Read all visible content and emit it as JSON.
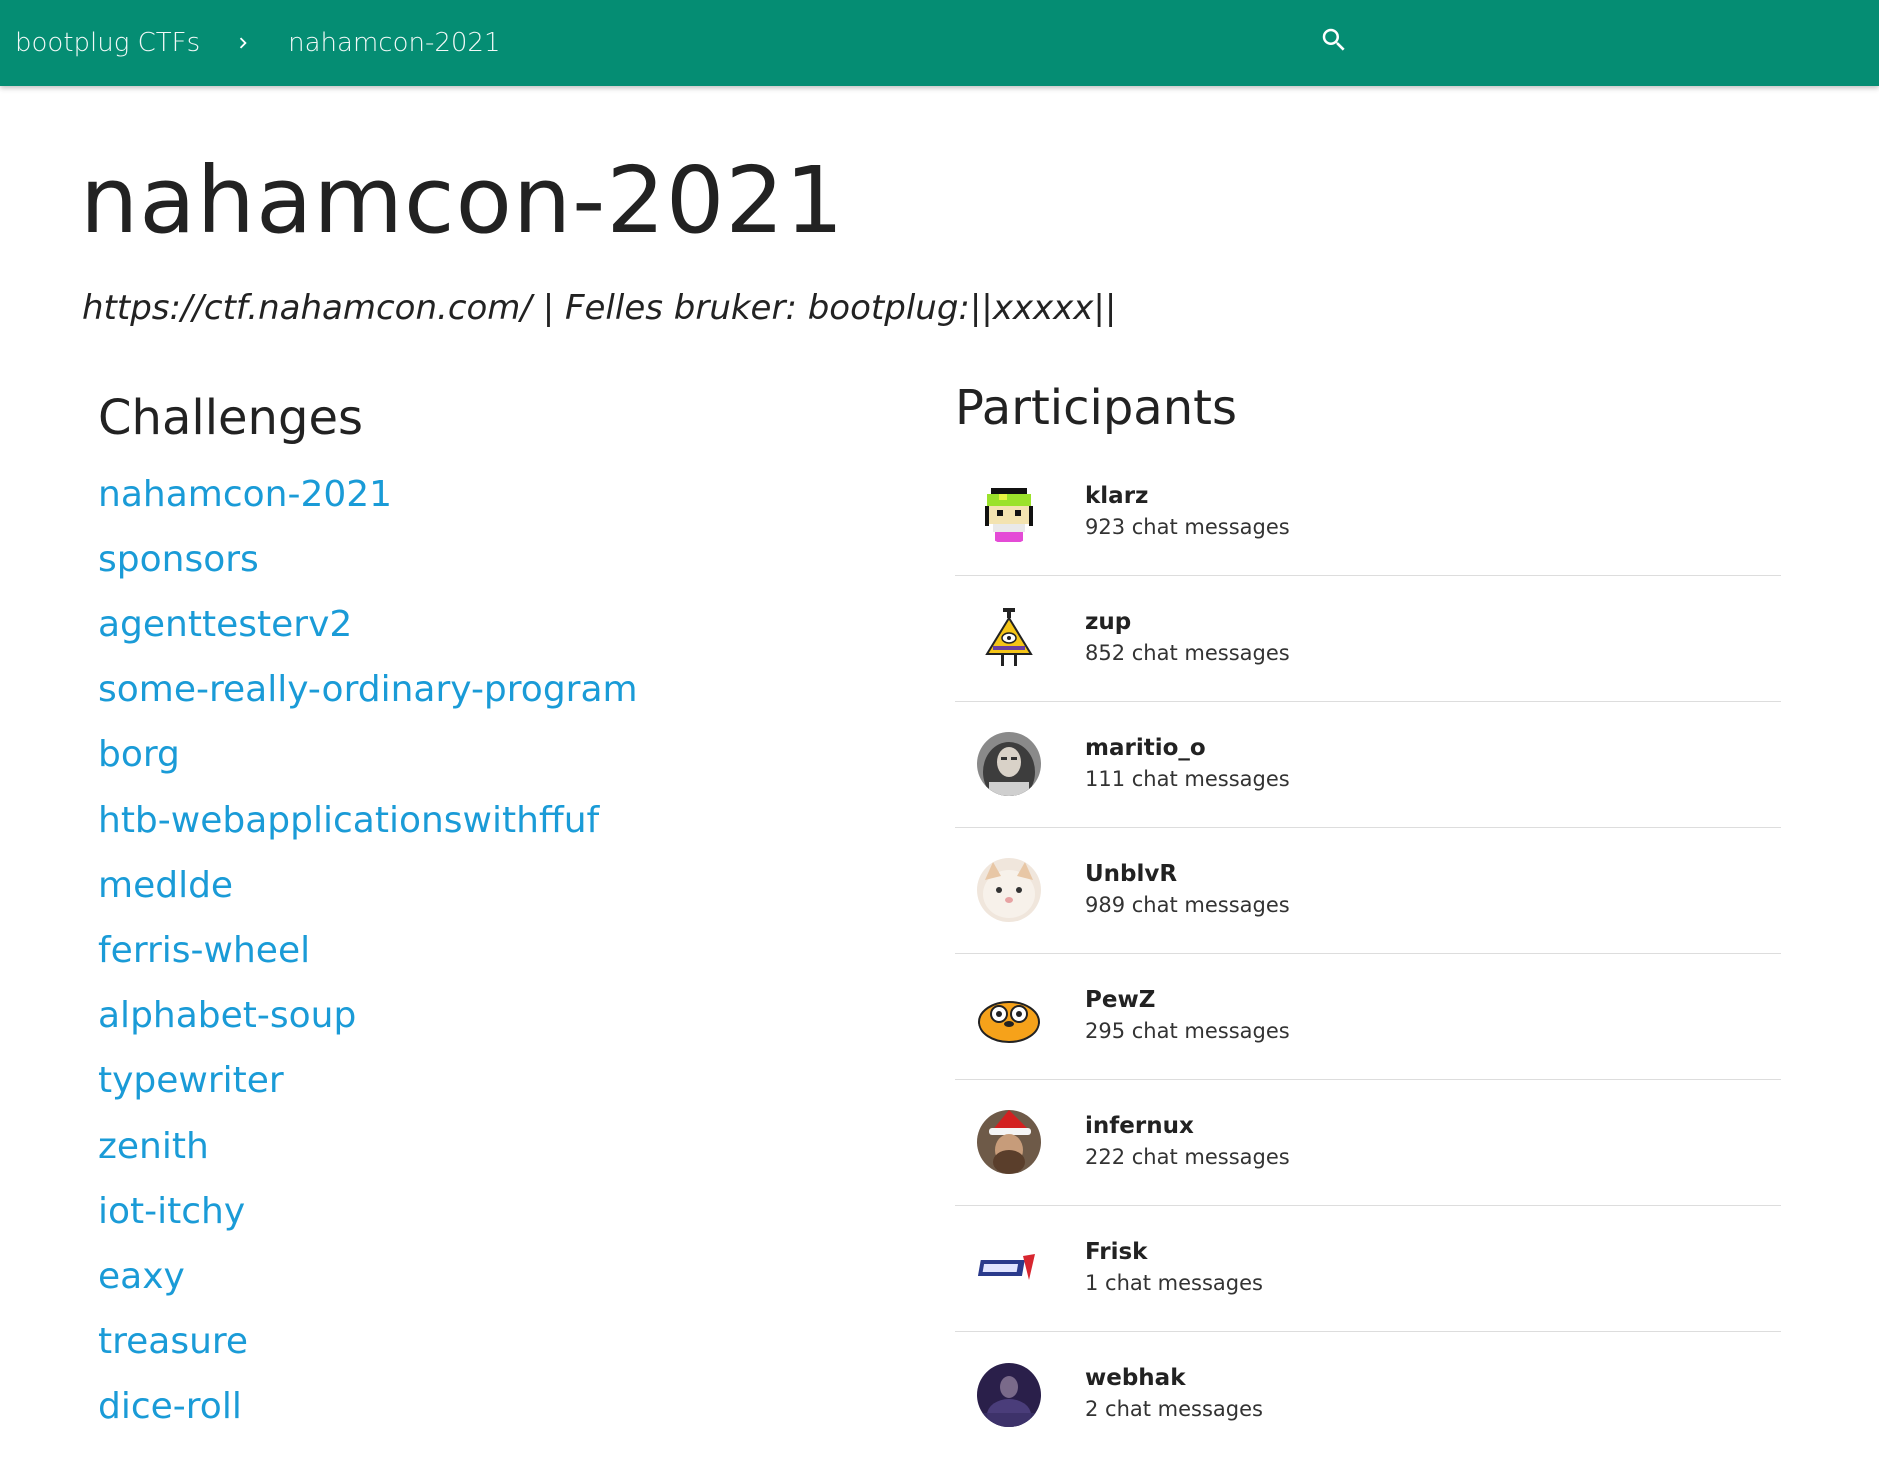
{
  "header": {
    "breadcrumb": [
      {
        "label": "bootplug CTFs"
      },
      {
        "label": "nahamcon-2021"
      }
    ],
    "icons": {
      "separator": "chevron-right-icon",
      "search": "search-icon"
    },
    "background_color": "#058d73"
  },
  "page": {
    "title": "nahamcon-2021",
    "subtitle": "https://ctf.nahamcon.com/ | Felles bruker: bootplug:||xxxxx||"
  },
  "challenges": {
    "heading": "Challenges",
    "link_color": "#1a9bd7",
    "items": [
      {
        "label": "nahamcon-2021"
      },
      {
        "label": "sponsors"
      },
      {
        "label": "agenttesterv2"
      },
      {
        "label": "some-really-ordinary-program"
      },
      {
        "label": "borg"
      },
      {
        "label": "htb-webapplicationswithffuf"
      },
      {
        "label": "medlde"
      },
      {
        "label": "ferris-wheel"
      },
      {
        "label": "alphabet-soup"
      },
      {
        "label": "typewriter"
      },
      {
        "label": "zenith"
      },
      {
        "label": "iot-itchy"
      },
      {
        "label": "eaxy"
      },
      {
        "label": "treasure"
      },
      {
        "label": "dice-roll"
      }
    ]
  },
  "participants": {
    "heading": "Participants",
    "items": [
      {
        "name": "klarz",
        "count": "923 chat messages",
        "avatar": "pixel-character-avatar"
      },
      {
        "name": "zup",
        "count": "852 chat messages",
        "avatar": "triangle-eye-avatar"
      },
      {
        "name": "maritio_o",
        "count": "111 chat messages",
        "avatar": "photo-avatar"
      },
      {
        "name": "UnblvR",
        "count": "989 chat messages",
        "avatar": "cat-avatar"
      },
      {
        "name": "PewZ",
        "count": "295 chat messages",
        "avatar": "cartoon-dog-avatar"
      },
      {
        "name": "infernux",
        "count": "222 chat messages",
        "avatar": "santa-hat-avatar"
      },
      {
        "name": "Frisk",
        "count": "1 chat messages",
        "avatar": "logo-avatar"
      },
      {
        "name": "webhak",
        "count": "2 chat messages",
        "avatar": "dark-photo-avatar"
      }
    ]
  }
}
